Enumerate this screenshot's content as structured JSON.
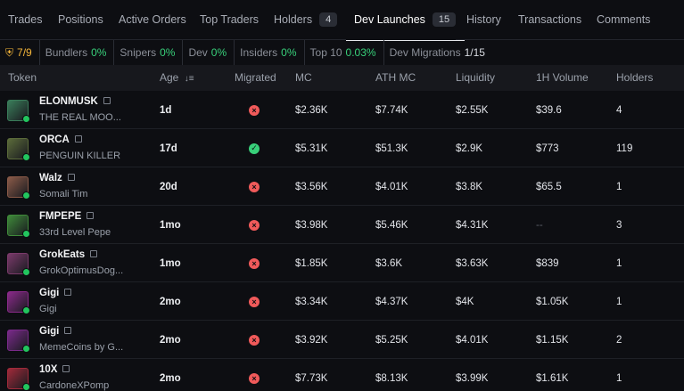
{
  "tabs": [
    {
      "label": "Trades"
    },
    {
      "label": "Positions"
    },
    {
      "label": "Active Orders"
    },
    {
      "label": "Top Traders"
    },
    {
      "label": "Holders",
      "badge": "4"
    },
    {
      "label": "Dev Launches",
      "badge": "15",
      "active": true
    },
    {
      "label": "History"
    },
    {
      "label": "Transactions"
    },
    {
      "label": "Comments"
    }
  ],
  "stats": {
    "score": "7/9",
    "bundlers_label": "Bundlers",
    "bundlers_value": "0%",
    "snipers_label": "Snipers",
    "snipers_value": "0%",
    "dev_label": "Dev",
    "dev_value": "0%",
    "insiders_label": "Insiders",
    "insiders_value": "0%",
    "top10_label": "Top 10",
    "top10_value": "0.03%",
    "migrations_label": "Dev Migrations",
    "migrations_value": "1/15"
  },
  "columns": {
    "token": "Token",
    "age": "Age",
    "migrated": "Migrated",
    "mc": "MC",
    "ath_mc": "ATH MC",
    "liquidity": "Liquidity",
    "volume": "1H Volume",
    "holders": "Holders"
  },
  "rows": [
    {
      "name": "ELONMUSK",
      "subtitle": "THE REAL MOO...",
      "age": "1d",
      "migrated": false,
      "mc": "$2.36K",
      "ath_mc": "$7.74K",
      "liquidity": "$2.55K",
      "volume": "$39.6",
      "holders": "4",
      "color": "#3a7d5a"
    },
    {
      "name": "ORCA",
      "subtitle": "PENGUIN KILLER",
      "age": "17d",
      "migrated": true,
      "mc": "$5.31K",
      "ath_mc": "$51.3K",
      "liquidity": "$2.9K",
      "volume": "$773",
      "holders": "119",
      "color": "#5b6b3a"
    },
    {
      "name": "Walz",
      "subtitle": "Somali Tim",
      "age": "20d",
      "migrated": false,
      "mc": "$3.56K",
      "ath_mc": "$4.01K",
      "liquidity": "$3.8K",
      "volume": "$65.5",
      "holders": "1",
      "color": "#8a5a48"
    },
    {
      "name": "FMPEPE",
      "subtitle": "33rd Level Pepe",
      "age": "1mo",
      "migrated": false,
      "mc": "$3.98K",
      "ath_mc": "$5.46K",
      "liquidity": "$4.31K",
      "volume": "--",
      "holders": "3",
      "color": "#3f8a3a"
    },
    {
      "name": "GrokEats",
      "subtitle": "GrokOptimusDog...",
      "age": "1mo",
      "migrated": false,
      "mc": "$1.85K",
      "ath_mc": "$3.6K",
      "liquidity": "$3.63K",
      "volume": "$839",
      "holders": "1",
      "color": "#7a3a6a"
    },
    {
      "name": "Gigi",
      "subtitle": "Gigi",
      "age": "2mo",
      "migrated": false,
      "mc": "$3.34K",
      "ath_mc": "$4.37K",
      "liquidity": "$4K",
      "volume": "$1.05K",
      "holders": "1",
      "color": "#8a2a8a"
    },
    {
      "name": "Gigi",
      "subtitle": "MemeCoins by G...",
      "age": "2mo",
      "migrated": false,
      "mc": "$3.92K",
      "ath_mc": "$5.25K",
      "liquidity": "$4.01K",
      "volume": "$1.15K",
      "holders": "2",
      "color": "#7a2a8a"
    },
    {
      "name": "10X",
      "subtitle": "CardoneXPomp",
      "age": "2mo",
      "migrated": false,
      "mc": "$7.73K",
      "ath_mc": "$8.13K",
      "liquidity": "$3.99K",
      "volume": "$1.61K",
      "holders": "1",
      "color": "#a02a3a"
    }
  ]
}
